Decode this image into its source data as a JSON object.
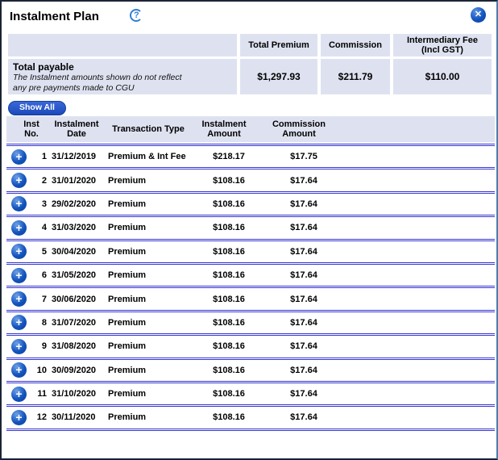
{
  "dialog": {
    "title": "Instalment Plan"
  },
  "icons": {
    "help_glyph": "?",
    "close_glyph": "✕",
    "plus_glyph": "+"
  },
  "colors": {
    "accent_blue": "#1254bd",
    "separator_blue": "#3737d2",
    "header_bg": "#dee2f0"
  },
  "summary": {
    "col_premium": "Total Premium",
    "col_commission": "Commission",
    "col_fee_line1": "Intermediary Fee",
    "col_fee_line2": "(Incl GST)",
    "row_label": "Total payable",
    "note_line1": "The Instalment amounts shown do not reflect",
    "note_line2": "any pre payments made to CGU",
    "value_premium": "$1,297.93",
    "value_commission": "$211.79",
    "value_fee": "$110.00"
  },
  "show_all_label": "Show All",
  "table": {
    "headers": {
      "no1": "Inst",
      "no2": "No.",
      "date1": "Instalment",
      "date2": "Date",
      "type1": "Transaction Type",
      "type2": "",
      "inst1": "Instalment",
      "inst2": "Amount",
      "comm1": "Commission",
      "comm2": "Amount"
    },
    "rows": [
      {
        "no": "1",
        "date": "31/12/2019",
        "type": "Premium & Int Fee",
        "amount": "$218.17",
        "commission": "$17.75"
      },
      {
        "no": "2",
        "date": "31/01/2020",
        "type": "Premium",
        "amount": "$108.16",
        "commission": "$17.64"
      },
      {
        "no": "3",
        "date": "29/02/2020",
        "type": "Premium",
        "amount": "$108.16",
        "commission": "$17.64"
      },
      {
        "no": "4",
        "date": "31/03/2020",
        "type": "Premium",
        "amount": "$108.16",
        "commission": "$17.64"
      },
      {
        "no": "5",
        "date": "30/04/2020",
        "type": "Premium",
        "amount": "$108.16",
        "commission": "$17.64"
      },
      {
        "no": "6",
        "date": "31/05/2020",
        "type": "Premium",
        "amount": "$108.16",
        "commission": "$17.64"
      },
      {
        "no": "7",
        "date": "30/06/2020",
        "type": "Premium",
        "amount": "$108.16",
        "commission": "$17.64"
      },
      {
        "no": "8",
        "date": "31/07/2020",
        "type": "Premium",
        "amount": "$108.16",
        "commission": "$17.64"
      },
      {
        "no": "9",
        "date": "31/08/2020",
        "type": "Premium",
        "amount": "$108.16",
        "commission": "$17.64"
      },
      {
        "no": "10",
        "date": "30/09/2020",
        "type": "Premium",
        "amount": "$108.16",
        "commission": "$17.64"
      },
      {
        "no": "11",
        "date": "31/10/2020",
        "type": "Premium",
        "amount": "$108.16",
        "commission": "$17.64"
      },
      {
        "no": "12",
        "date": "30/11/2020",
        "type": "Premium",
        "amount": "$108.16",
        "commission": "$17.64"
      }
    ]
  }
}
